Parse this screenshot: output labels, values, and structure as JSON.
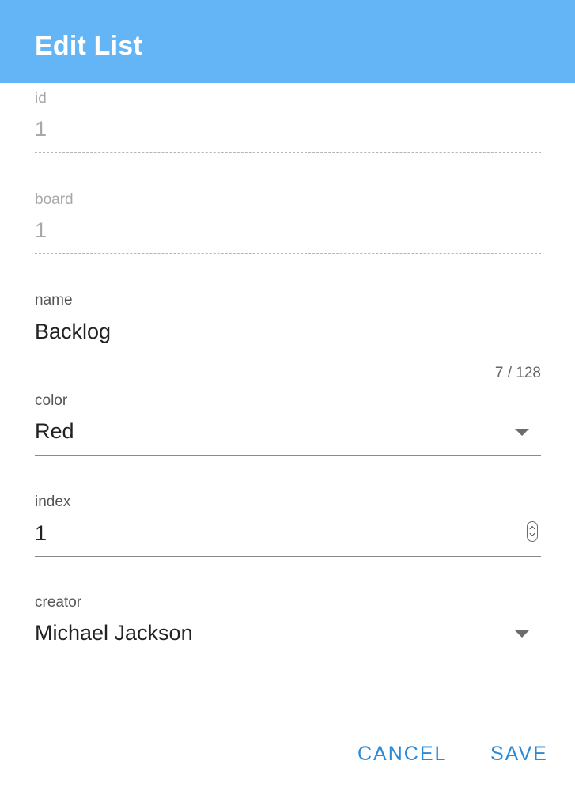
{
  "dialog": {
    "title": "Edit List",
    "header_color": "#64b5f6",
    "accent_color": "#2b8ad8"
  },
  "fields": {
    "id": {
      "label": "id",
      "value": "1",
      "disabled": true
    },
    "board": {
      "label": "board",
      "value": "1",
      "disabled": true
    },
    "name": {
      "label": "name",
      "value": "Backlog",
      "counter": "7 / 128"
    },
    "color": {
      "label": "color",
      "value": "Red",
      "icon": "dropdown-arrow-icon"
    },
    "index": {
      "label": "index",
      "value": "1",
      "icon": "number-spinner-icon"
    },
    "creator": {
      "label": "creator",
      "value": "Michael Jackson",
      "icon": "dropdown-arrow-icon"
    }
  },
  "actions": {
    "cancel_label": "CANCEL",
    "save_label": "SAVE"
  }
}
